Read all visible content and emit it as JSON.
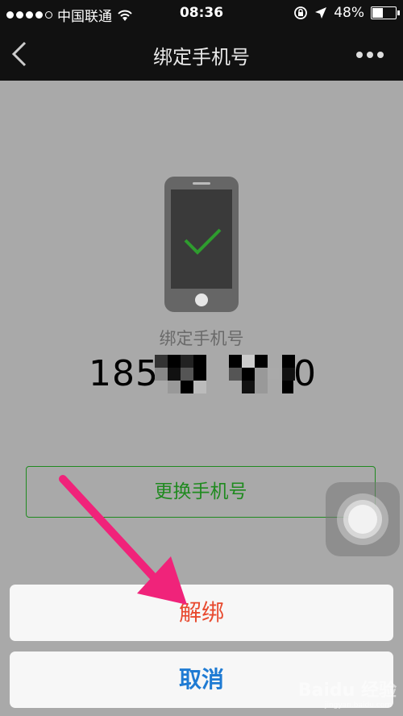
{
  "status_bar": {
    "carrier": "中国联通",
    "time": "08:36",
    "battery": "48%",
    "battery_level": 0.48
  },
  "nav": {
    "title": "绑定手机号",
    "back_icon": "chevron-left-icon",
    "more_icon": "more-dots-icon"
  },
  "content": {
    "bound_label": "绑定手机号",
    "phone_number_visible": "185",
    "phone_number_tail": "0",
    "phone_icon": "phone-checkmark-icon",
    "check_color": "#2e9c2e"
  },
  "actions": {
    "change_label": "更换手机号",
    "unbind_label": "解绑",
    "cancel_label": "取消"
  },
  "colors": {
    "accent_green": "#1f8a1f",
    "destructive_red": "#e84a2f",
    "cancel_blue": "#1f7bd3",
    "annotation_pink": "#f0237a"
  },
  "watermark": {
    "text": "Baidu 经验",
    "sub": "jingyan.baidu.com"
  }
}
